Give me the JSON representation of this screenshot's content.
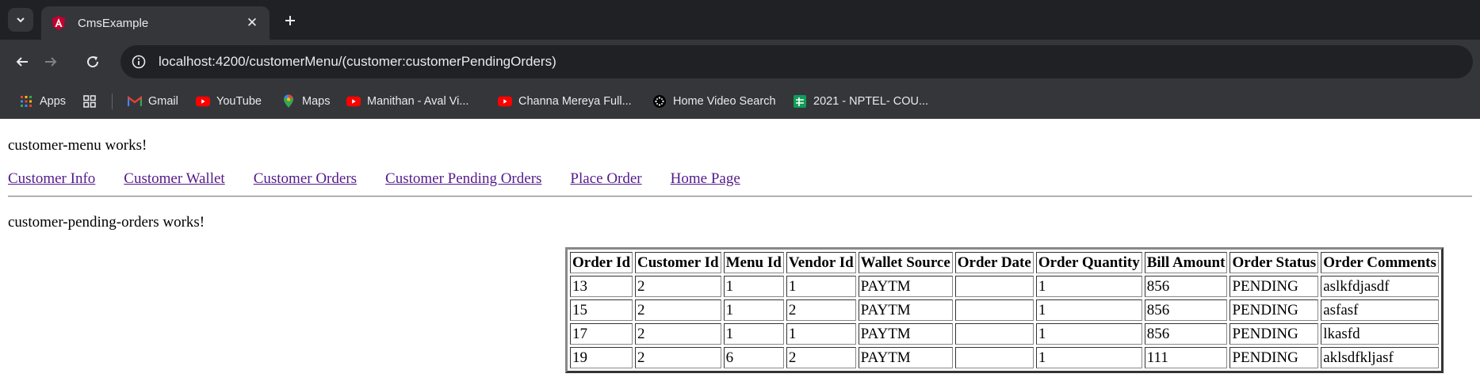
{
  "browser": {
    "tab_title": "CmsExample",
    "url": "localhost:4200/customerMenu/(customer:customerPendingOrders)",
    "bookmarks": [
      {
        "label": "Apps",
        "icon": "apps-grid-icon"
      },
      {
        "label": "",
        "icon": "tab-groups-icon"
      },
      {
        "label": "Gmail",
        "icon": "gmail-icon"
      },
      {
        "label": "YouTube",
        "icon": "youtube-icon"
      },
      {
        "label": "Maps",
        "icon": "maps-pin-icon"
      },
      {
        "label": "Manithan - Aval Vi...",
        "icon": "youtube-icon"
      },
      {
        "label": "Channa Mereya Full...",
        "icon": "youtube-icon"
      },
      {
        "label": "Home Video Search",
        "icon": "circle-dots-icon"
      },
      {
        "label": "2021 - NPTEL- COU...",
        "icon": "sheets-icon"
      }
    ],
    "colors": {
      "tabstrip": "#202124",
      "toolbar": "#35363a",
      "text": "#e8eaed"
    }
  },
  "page": {
    "menu_works": "customer-menu works!",
    "nav_links": [
      "Customer Info",
      "Customer Wallet",
      "Customer Orders",
      "Customer Pending Orders",
      "Place Order",
      "Home Page"
    ],
    "pending_works": "customer-pending-orders works!",
    "table": {
      "headers": [
        "Order Id",
        "Customer Id",
        "Menu Id",
        "Vendor Id",
        "Wallet Source",
        "Order Date",
        "Order Quantity",
        "Bill Amount",
        "Order Status",
        "Order Comments"
      ],
      "rows": [
        [
          "13",
          "2",
          "1",
          "1",
          "PAYTM",
          "",
          "1",
          "856",
          "PENDING",
          "aslkfdjasdf"
        ],
        [
          "15",
          "2",
          "1",
          "2",
          "PAYTM",
          "",
          "1",
          "856",
          "PENDING",
          "asfasf"
        ],
        [
          "17",
          "2",
          "1",
          "1",
          "PAYTM",
          "",
          "1",
          "856",
          "PENDING",
          "lkasfd"
        ],
        [
          "19",
          "2",
          "6",
          "2",
          "PAYTM",
          "",
          "1",
          "111",
          "PENDING",
          "aklsdfkljasf"
        ]
      ]
    },
    "link_color": "#551a8b"
  }
}
